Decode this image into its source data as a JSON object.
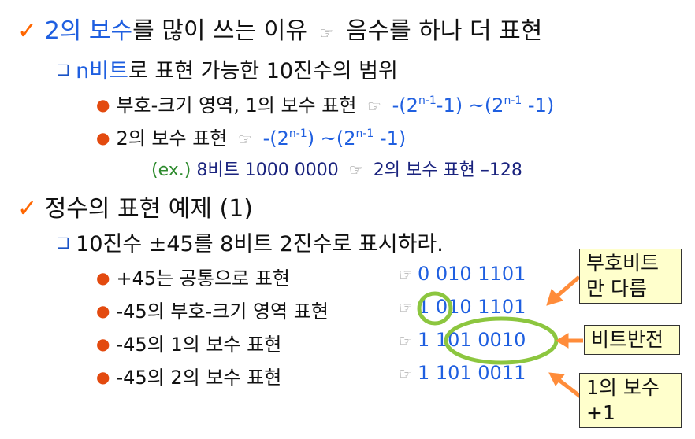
{
  "check_mark": "✓",
  "square_mark": "❑",
  "bullet_mark": "●",
  "pointer_mark": "☞",
  "section1": {
    "title_part1": "2의 보수",
    "title_part2": "를 많이 쓰는 이유",
    "title_part3": "음수를 하나 더 표현",
    "sub_blue": "n비트",
    "sub_rest": "로 표현 가능한 10진수의 범위",
    "item1_label": "부호-크기 영역, 1의 보수 표현",
    "item1_range": {
      "a": "-(2",
      "b": "n-1",
      "c": "-1) ~(2",
      "d": "n-1",
      "e": " -1)"
    },
    "item2_label": "2의 보수 표현",
    "item2_range": {
      "a": "-(2",
      "b": "n-1",
      "c": ") ~(2",
      "d": "n-1",
      "e": " -1)"
    },
    "example_tag": "(ex.)",
    "example_left": "8비트 1000 0000",
    "example_right": "2의 보수 표현 –128"
  },
  "section2": {
    "title": "정수의 표현 예제 (1)",
    "sub": "10진수 ±45를 8비트 2진수로 표시하라.",
    "rows": [
      {
        "label": "+45는 공통으로 표현",
        "value": "0 010 1101"
      },
      {
        "label": "-45의 부호-크기 영역 표현",
        "value": "1 010 1101"
      },
      {
        "label": "-45의 1의 보수 표현",
        "value": "1 101 0010"
      },
      {
        "label": "-45의 2의 보수 표현",
        "value": "1 101 0011"
      }
    ]
  },
  "callouts": {
    "sign_bit": "부호비트\n만 다름",
    "bit_flip": "비트반전",
    "ones_plus": "1의 보수\n+1"
  },
  "colors": {
    "accent_orange": "#ff6600",
    "text_blue": "#1f5fe0",
    "highlight_green": "#8cc63f",
    "callout_bg": "#ffffcc"
  }
}
